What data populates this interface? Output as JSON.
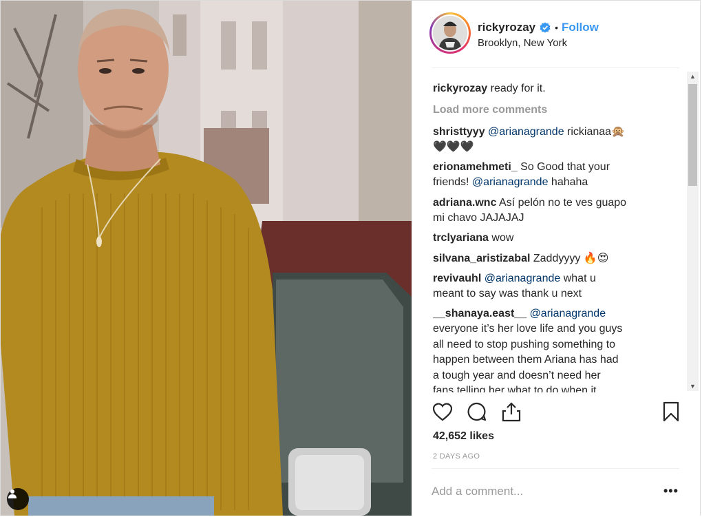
{
  "post": {
    "username": "rickyrozay",
    "follow_label": "Follow",
    "dot_separator": "•",
    "location": "Brooklyn, New York",
    "caption": {
      "username": "rickyrozay",
      "text": " ready for it."
    },
    "load_more": "Load more comments",
    "comments": [
      {
        "username": "shristtyyy",
        "mention": "@arianagrande",
        "text": " rickianaa🙊",
        "text2": "🖤🖤🖤"
      },
      {
        "username": "erionamehmeti_",
        "text": " So Good that your",
        "mention_line2": "@arianagrande",
        "text2_pre": "friends! ",
        "text2_post": " hahaha"
      },
      {
        "username": "adriana.wnc",
        "text": " Así pelón no te ves guapo",
        "text2": "mi chavo JAJAJAJ"
      },
      {
        "username": "trclyariana",
        "text": " wow"
      },
      {
        "username": "silvana_aristizabal",
        "text": " Zaddyyyy 🔥😍"
      },
      {
        "username": "revivauhl",
        "mention": "@arianagrande",
        "text": " what u",
        "text2": "meant to say was thank u next"
      },
      {
        "username": "__shanaya.east__",
        "mention": "@arianagrande",
        "lines": [
          "everyone it’s her love life and you guys",
          "all need to stop pushing something to",
          "happen between them Ariana has had",
          "a tough year and doesn’t need her",
          "fans telling her what to do when it"
        ]
      }
    ],
    "likes": "42,652 likes",
    "date": "2 DAYS AGO",
    "add_comment_placeholder": "Add a comment...",
    "more_options": "•••"
  },
  "icons": {
    "verified": "verified-badge-icon",
    "heart": "heart-outline-icon",
    "comment": "comment-bubble-icon",
    "share": "share-upload-icon",
    "save": "bookmark-icon",
    "tag": "user-tag-icon"
  },
  "colors": {
    "link": "#3897f0",
    "mention": "#003569",
    "muted": "#999999",
    "text": "#262626"
  }
}
